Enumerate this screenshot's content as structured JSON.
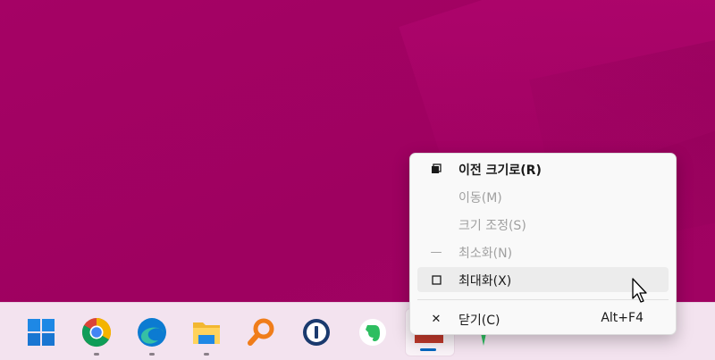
{
  "window_menu": {
    "items": [
      {
        "label": "이전 크기로(R)",
        "icon": "restore-icon",
        "enabled": true,
        "bold": true
      },
      {
        "label": "이동(M)",
        "icon": "",
        "enabled": false
      },
      {
        "label": "크기 조정(S)",
        "icon": "",
        "enabled": false
      },
      {
        "label": "최소화(N)",
        "icon": "minimize-icon",
        "icon_glyph": "—",
        "enabled": false
      },
      {
        "label": "최대화(X)",
        "icon": "maximize-icon",
        "enabled": true,
        "hovered": true
      },
      {
        "label": "닫기(C)",
        "icon": "close-icon",
        "icon_glyph": "✕",
        "enabled": true,
        "shortcut": "Alt+F4"
      }
    ]
  },
  "taskbar": {
    "apps": [
      {
        "name": "windows-start"
      },
      {
        "name": "chrome",
        "running": true
      },
      {
        "name": "edge",
        "running": true
      },
      {
        "name": "file-explorer",
        "running": true
      },
      {
        "name": "search-tool"
      },
      {
        "name": "1password"
      },
      {
        "name": "evernote"
      },
      {
        "name": "active-app",
        "active": true
      }
    ]
  },
  "colors": {
    "desktop": "#a10262",
    "taskbar": "#f3e3ef",
    "menu_bg": "#f9f9f9",
    "active_indicator": "#0067c0"
  }
}
